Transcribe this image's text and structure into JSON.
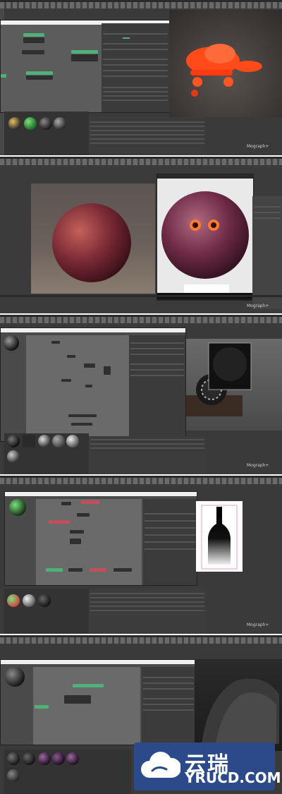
{
  "panels": [
    {
      "id": "panel-1",
      "mograph": "Mograph+"
    },
    {
      "id": "panel-2",
      "mograph": "Mograph+"
    },
    {
      "id": "panel-3",
      "mograph": "Mograph+"
    },
    {
      "id": "panel-4",
      "mograph": "Mograph+"
    },
    {
      "id": "panel-5",
      "mograph": ""
    }
  ],
  "colors": {
    "ui_dark": "#3a3a3a",
    "node_green": "#4fb07a",
    "node_red": "#c0505a",
    "brand_blue": "#2c4a8a",
    "toy_orange": "#ff4a1a"
  },
  "watermark": {
    "name": "云瑞",
    "domain": "YRUCD.COM",
    "icon": "cloud-icon"
  }
}
